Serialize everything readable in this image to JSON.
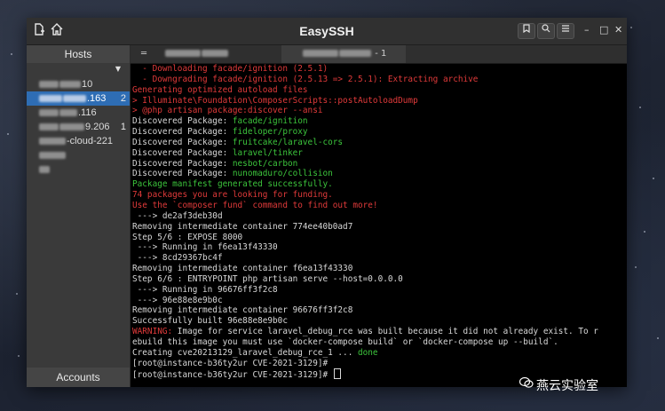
{
  "window": {
    "title": "EasySSH",
    "new_icon": "new-document-icon",
    "home_icon": "home-icon",
    "buttons": [
      "bookmark-icon",
      "search-icon",
      "menu-icon"
    ],
    "controls": {
      "minimize": "–",
      "maximize": "□",
      "close": "✕"
    }
  },
  "sidebar": {
    "header": "Hosts",
    "footer": "Accounts",
    "hosts": [
      {
        "suffix": "10",
        "count": "",
        "selected": false
      },
      {
        "suffix": ".163",
        "count": "2",
        "selected": true
      },
      {
        "suffix": ".116",
        "count": "",
        "selected": false
      },
      {
        "suffix": "9.206",
        "count": "1",
        "selected": false
      },
      {
        "suffix": "-cloud-221",
        "count": "",
        "selected": false
      },
      {
        "suffix": "",
        "count": "",
        "selected": false
      },
      {
        "suffix": "",
        "count": "",
        "selected": false
      }
    ]
  },
  "tabs": [
    {
      "label": "",
      "active": false
    },
    {
      "label": "- 1",
      "active": true
    }
  ],
  "terminal": {
    "lines": [
      {
        "text": "  - Downloading facade/ignition (2.5.1)",
        "color": "red"
      },
      {
        "text": "  - Downgrading facade/ignition (2.5.13 => 2.5.1): Extracting archive",
        "color": "red"
      },
      {
        "text": "Generating optimized autoload files",
        "color": "red"
      },
      {
        "text": "> Illuminate\\Foundation\\ComposerScripts::postAutoloadDump",
        "color": "red"
      },
      {
        "text": "> @php artisan package:discover --ansi",
        "color": "red"
      },
      {
        "text": "Discovered Package: ",
        "pkg": "facade/ignition"
      },
      {
        "text": "Discovered Package: ",
        "pkg": "fideloper/proxy"
      },
      {
        "text": "Discovered Package: ",
        "pkg": "fruitcake/laravel-cors"
      },
      {
        "text": "Discovered Package: ",
        "pkg": "laravel/tinker"
      },
      {
        "text": "Discovered Package: ",
        "pkg": "nesbot/carbon"
      },
      {
        "text": "Discovered Package: ",
        "pkg": "nunomaduro/collision"
      },
      {
        "text": "Package manifest generated successfully.",
        "color": "green"
      },
      {
        "text": "74 packages you are looking for funding.",
        "color": "red"
      },
      {
        "text": "Use the `composer fund` command to find out more!",
        "color": "red"
      },
      {
        "text": " ---> de2af3deb30d",
        "color": ""
      },
      {
        "text": "Removing intermediate container 774ee40b0ad7",
        "color": ""
      },
      {
        "text": "Step 5/6 : EXPOSE 8000",
        "color": ""
      },
      {
        "text": " ---> Running in f6ea13f43330",
        "color": ""
      },
      {
        "text": " ---> 8cd29367bc4f",
        "color": ""
      },
      {
        "text": "Removing intermediate container f6ea13f43330",
        "color": ""
      },
      {
        "text": "Step 6/6 : ENTRYPOINT php artisan serve --host=0.0.0.0",
        "color": ""
      },
      {
        "text": " ---> Running in 96676ff3f2c8",
        "color": ""
      },
      {
        "text": " ---> 96e88e8e9b0c",
        "color": ""
      },
      {
        "text": "Removing intermediate container 96676ff3f2c8",
        "color": ""
      },
      {
        "text": "Successfully built 96e88e8e9b0c",
        "color": ""
      },
      {
        "text": "WARNING:",
        "rest": " Image for service laravel_debug_rce was built because it did not already exist. To r"
      },
      {
        "text": "ebuild this image you must use `docker-compose build` or `docker-compose up --build`.",
        "color": ""
      },
      {
        "text": "Creating cve20213129_laravel_debug_rce_1 ... ",
        "done": "done"
      },
      {
        "text": "[root@instance-b36ty2ur CVE-2021-3129]#",
        "color": ""
      },
      {
        "text": "[root@instance-b36ty2ur CVE-2021-3129]# ",
        "cursor": true
      }
    ]
  },
  "watermark": {
    "text": "燕云实验室",
    "icon": "wechat-icon"
  }
}
